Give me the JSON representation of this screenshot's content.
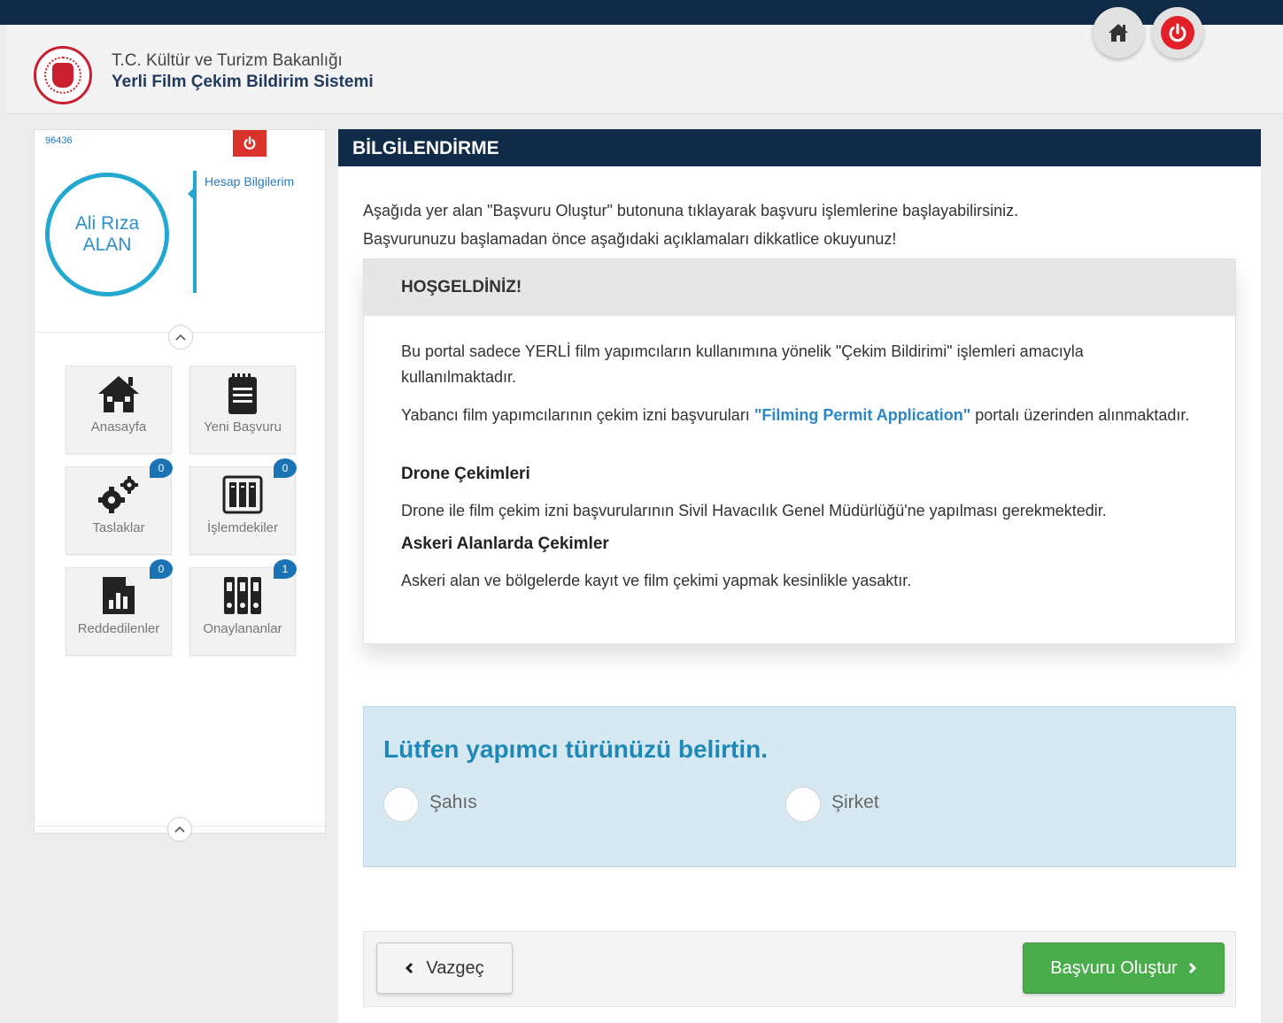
{
  "header": {
    "org_name": "T.C. Kültür ve Turizm Bakanlığı",
    "app_name": "Yerli Film Çekim Bildirim Sistemi",
    "home_icon": "home-icon",
    "power_icon": "power-icon"
  },
  "sidebar": {
    "user_id": "96436",
    "user_name_line1": "Ali Rıza",
    "user_name_line2": "ALAN",
    "account_link": "Hesap Bilgilerim",
    "tiles": [
      {
        "label": "Anasayfa",
        "icon": "home-icon"
      },
      {
        "label": "Yeni Başvuru",
        "icon": "clipboard-icon"
      },
      {
        "label": "Taslaklar",
        "icon": "gears-icon",
        "badge": "0"
      },
      {
        "label": "İşlemdekiler",
        "icon": "archive-icon",
        "badge": "0"
      },
      {
        "label": "Reddedilenler",
        "icon": "report-icon",
        "badge": "0"
      },
      {
        "label": "Onaylananlar",
        "icon": "binders-icon",
        "badge": "1"
      }
    ]
  },
  "main": {
    "title": "BİLGİLENDİRME",
    "intro_line1": "Aşağıda yer alan \"Başvuru Oluştur\" butonuna tıklayarak başvuru işlemlerine başlayabilirsiniz.",
    "intro_line2": "Başvurunuzu başlamadan önce aşağıdaki açıklamaları dikkatlice okuyunuz!",
    "welcome": {
      "title": "HOŞGELDİNİZ!",
      "p1": "Bu portal sadece YERLİ film yapımcıların kullanımına yönelik \"Çekim Bildirimi\" işlemleri amacıyla kullanılmaktadır.",
      "p2_before": "Yabancı film yapımcılarının çekim izni başvuruları ",
      "p2_link": "\"Filming Permit Application\"",
      "p2_after": " portalı üzerinden alınmaktadır.",
      "h1": "Drone Çekimleri",
      "p3": "Drone ile film çekim izni başvurularının Sivil Havacılık Genel Müdürlüğü'ne yapılması gerekmektedir.",
      "h2": "Askeri Alanlarda Çekimler",
      "p4": "Askeri alan ve bölgelerde kayıt ve film çekimi yapmak kesinlikle yasaktır."
    },
    "producer_type": {
      "title": "Lütfen yapımcı türünüzü belirtin.",
      "option1": "Şahıs",
      "option2": "Şirket"
    },
    "buttons": {
      "cancel": "Vazgeç",
      "create": "Başvuru Oluştur"
    }
  },
  "colors": {
    "header_dark": "#0f2b47",
    "accent_blue": "#23a9d0",
    "create_green": "#4aad4c",
    "logout_red": "#e3202a"
  }
}
